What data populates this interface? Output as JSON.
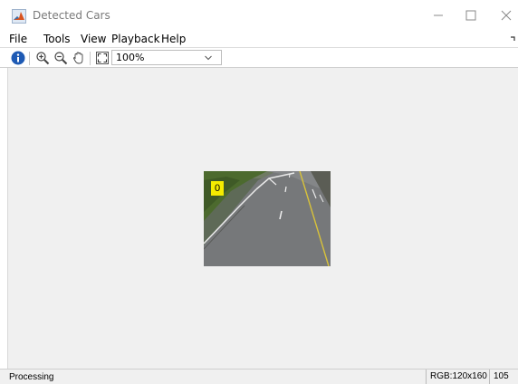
{
  "window": {
    "title": "Detected Cars",
    "icon": "matlab-icon",
    "controls": [
      "minimize-icon",
      "maximize-icon",
      "close-icon"
    ]
  },
  "menu": {
    "items": [
      {
        "label": "File"
      },
      {
        "label": "Tools"
      },
      {
        "label": "View"
      },
      {
        "label": "Playback"
      },
      {
        "label": "Help"
      }
    ]
  },
  "toolbar": {
    "icons": [
      "info-icon",
      "zoom-in-icon",
      "zoom-out-icon",
      "pan-hand-icon",
      "fit-to-window-icon"
    ],
    "zoom_value": "100%"
  },
  "image": {
    "detection_label": "0",
    "colors": {
      "detection_box": "#f5ec00",
      "road": "#76787a",
      "grass": "#4c6a2e"
    }
  },
  "status": {
    "text": "Processing",
    "image_info": "RGB:120x160",
    "frame": "105"
  }
}
